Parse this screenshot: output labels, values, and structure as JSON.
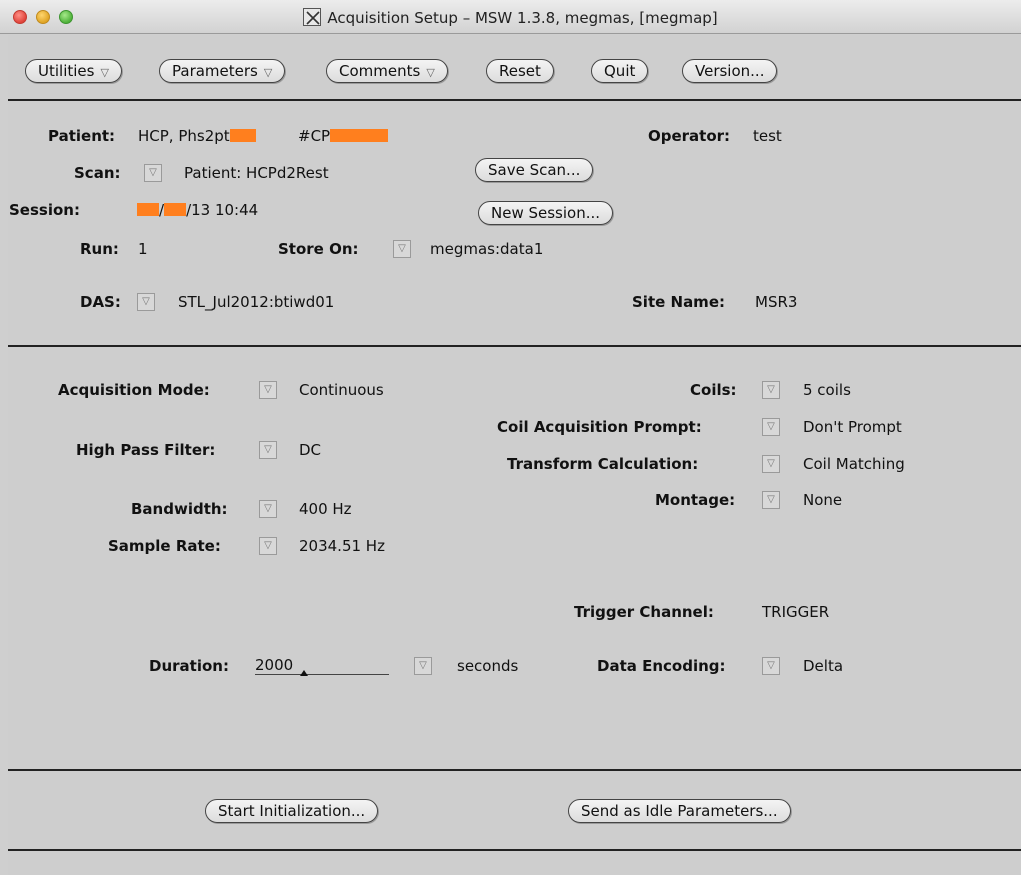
{
  "window": {
    "title": "Acquisition Setup – MSW 1.3.8, megmas, [megmap]"
  },
  "toolbar": {
    "utilities": "Utilities",
    "parameters": "Parameters",
    "comments": "Comments",
    "reset": "Reset",
    "quit": "Quit",
    "version": "Version..."
  },
  "patient": {
    "patient_label": "Patient:",
    "patient_value": "HCP, Phs2pt",
    "patient_id_prefix": "#CP",
    "operator_label": "Operator:",
    "operator_value": "test",
    "scan_label": "Scan:",
    "scan_value": "Patient:  HCPd2Rest",
    "save_scan": "Save Scan...",
    "session_label": "Session:",
    "session_sep": "/",
    "session_value": "/13 10:44",
    "new_session": "New Session...",
    "run_label": "Run:",
    "run_value": "1",
    "store_on_label": "Store On:",
    "store_on_value": "megmas:data1",
    "das_label": "DAS:",
    "das_value": "STL_Jul2012:btiwd01",
    "site_name_label": "Site Name:",
    "site_name_value": "MSR3"
  },
  "acquisition": {
    "mode_label": "Acquisition Mode:",
    "mode_value": "Continuous",
    "high_pass_label": "High Pass Filter:",
    "high_pass_value": "DC",
    "bandwidth_label": "Bandwidth:",
    "bandwidth_value": "400 Hz",
    "sample_rate_label": "Sample Rate:",
    "sample_rate_value": "2034.51 Hz",
    "coils_label": "Coils:",
    "coils_value": "5 coils",
    "coil_prompt_label": "Coil Acquisition Prompt:",
    "coil_prompt_value": "Don't Prompt",
    "transform_label": "Transform Calculation:",
    "transform_value": "Coil Matching",
    "montage_label": "Montage:",
    "montage_value": "None",
    "trigger_label": "Trigger Channel:",
    "trigger_value": "TRIGGER",
    "duration_label": "Duration:",
    "duration_value": "2000",
    "duration_unit": "seconds",
    "encoding_label": "Data Encoding:",
    "encoding_value": "Delta"
  },
  "actions": {
    "start_init": "Start Initialization...",
    "send_idle": "Send as Idle Parameters..."
  },
  "colors": {
    "redaction": "#ff7f1e",
    "window_bg": "#cecece"
  }
}
